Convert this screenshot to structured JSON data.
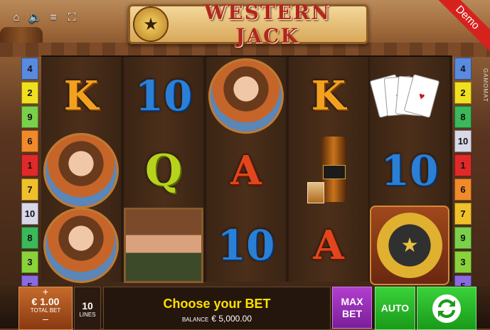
{
  "top_icons": [
    {
      "name": "home-icon",
      "glyph": "⌂"
    },
    {
      "name": "sound-icon",
      "glyph": "🔈"
    },
    {
      "name": "menu-icon",
      "glyph": "≡"
    },
    {
      "name": "fullscreen-icon",
      "glyph": "⛶"
    }
  ],
  "logo": {
    "text": "WESTERN JACK",
    "badge_glyph": "★"
  },
  "demo_label": "Demo",
  "side_brand": "GAMOMAT",
  "paylines_left": [
    "4",
    "2",
    "9",
    "6",
    "1",
    "7",
    "10",
    "8",
    "3",
    "5"
  ],
  "paylines_right": [
    "4",
    "2",
    "8",
    "10",
    "1",
    "6",
    "7",
    "9",
    "3",
    "5"
  ],
  "payline_colors": {
    "1": "#e02a2a",
    "2": "#f0e020",
    "3": "#8ad23a",
    "4": "#5a8ae0",
    "5": "#8a6ae0",
    "6": "#f08a2a",
    "7": "#f0c02a",
    "8": "#3ab85a",
    "9": "#7ad04a",
    "10": "#d8d8e8"
  },
  "reels": [
    [
      {
        "type": "letter",
        "value": "K",
        "cls": "kq"
      },
      {
        "type": "portrait",
        "value": "cowgirl"
      },
      {
        "type": "portrait",
        "value": "cowgirl"
      }
    ],
    [
      {
        "type": "letter",
        "value": "10",
        "cls": "ten"
      },
      {
        "type": "letter",
        "value": "Q",
        "cls": "q"
      },
      {
        "type": "cowboy",
        "value": "cowboy"
      }
    ],
    [
      {
        "type": "portrait",
        "value": "cowgirl"
      },
      {
        "type": "letter",
        "value": "A",
        "cls": "ace"
      },
      {
        "type": "letter",
        "value": "10",
        "cls": "ten"
      }
    ],
    [
      {
        "type": "letter",
        "value": "K",
        "cls": "kq"
      },
      {
        "type": "whisky",
        "value": "whisky"
      },
      {
        "type": "letter",
        "value": "A",
        "cls": "ace"
      }
    ],
    [
      {
        "type": "cards",
        "value": "cards"
      },
      {
        "type": "letter",
        "value": "10",
        "cls": "ten"
      },
      {
        "type": "sheriff",
        "value": "sheriff-star"
      }
    ]
  ],
  "bet": {
    "plus": "+",
    "value": "€ 1.00",
    "label": "TOTAL BET",
    "minus": "–"
  },
  "lines": {
    "value": "10",
    "label": "LINES"
  },
  "message": {
    "title": "Choose your BET",
    "balance_label": "BALANCE",
    "balance_value": "€ 5,000.00"
  },
  "buttons": {
    "max_bet": "MAX BET",
    "auto": "AUTO"
  }
}
